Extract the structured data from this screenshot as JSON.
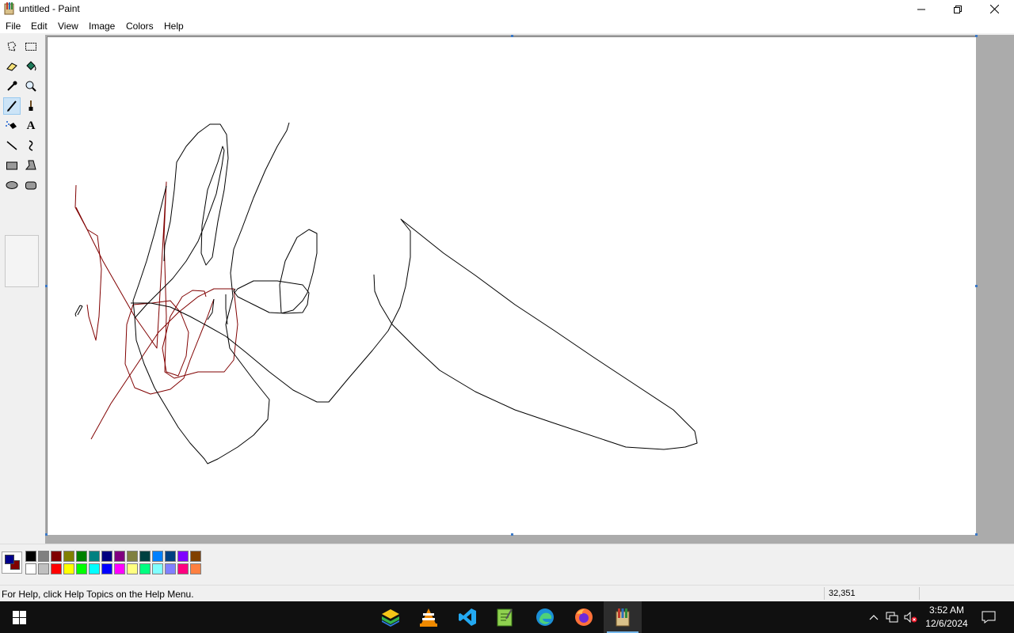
{
  "window": {
    "title": "untitled - Paint",
    "icon": "paint-icon",
    "controls": [
      "minimize-icon",
      "restore-icon",
      "close-icon"
    ]
  },
  "menu": {
    "items": [
      "File",
      "Edit",
      "View",
      "Image",
      "Colors",
      "Help"
    ]
  },
  "tools": [
    {
      "name": "free-form-select",
      "icon": "free-select-icon"
    },
    {
      "name": "select",
      "icon": "rect-select-icon"
    },
    {
      "name": "eraser",
      "icon": "eraser-icon"
    },
    {
      "name": "fill-with-color",
      "icon": "fill-bucket-icon"
    },
    {
      "name": "pick-color",
      "icon": "eyedropper-icon"
    },
    {
      "name": "magnifier",
      "icon": "magnifier-icon"
    },
    {
      "name": "pencil",
      "icon": "pencil-icon",
      "selected": true
    },
    {
      "name": "brush",
      "icon": "brush-icon"
    },
    {
      "name": "airbrush",
      "icon": "airbrush-icon"
    },
    {
      "name": "text",
      "icon": "text-icon",
      "glyph": "A"
    },
    {
      "name": "line",
      "icon": "line-icon"
    },
    {
      "name": "curve",
      "icon": "curve-icon"
    },
    {
      "name": "rectangle",
      "icon": "rectangle-icon"
    },
    {
      "name": "polygon",
      "icon": "polygon-icon"
    },
    {
      "name": "ellipse",
      "icon": "ellipse-icon"
    },
    {
      "name": "rounded-rectangle",
      "icon": "rounded-rect-icon"
    }
  ],
  "colors": {
    "foreground": "#00008b",
    "background": "#800000",
    "palette_top": [
      "#000000",
      "#808080",
      "#800000",
      "#808000",
      "#008000",
      "#008080",
      "#000080",
      "#800080",
      "#808040",
      "#004040",
      "#0080ff",
      "#004080",
      "#8000ff",
      "#804000"
    ],
    "palette_bottom": [
      "#ffffff",
      "#c0c0c0",
      "#ff0000",
      "#ffff00",
      "#00ff00",
      "#00ffff",
      "#0000ff",
      "#ff00ff",
      "#ffff80",
      "#00ff80",
      "#80ffff",
      "#8080ff",
      "#ff0080",
      "#ff8040"
    ],
    "stroke_black": "#000000",
    "stroke_red": "#800000"
  },
  "status": {
    "help_text": "For Help, click Help Topics on the Help Menu.",
    "coordinates": "32,351"
  },
  "taskbar": {
    "apps": [
      {
        "name": "bluestacks-icon"
      },
      {
        "name": "vlc-icon"
      },
      {
        "name": "vscode-icon"
      },
      {
        "name": "notepad-plus-icon"
      },
      {
        "name": "edge-icon"
      },
      {
        "name": "firefox-icon"
      },
      {
        "name": "paint-icon",
        "active": true
      }
    ],
    "tray_icons": [
      "chevron-up-icon",
      "network-icon",
      "volume-muted-icon"
    ],
    "time": "3:52 AM",
    "date": "12/6/2024",
    "notification_icon": "notification-icon"
  }
}
